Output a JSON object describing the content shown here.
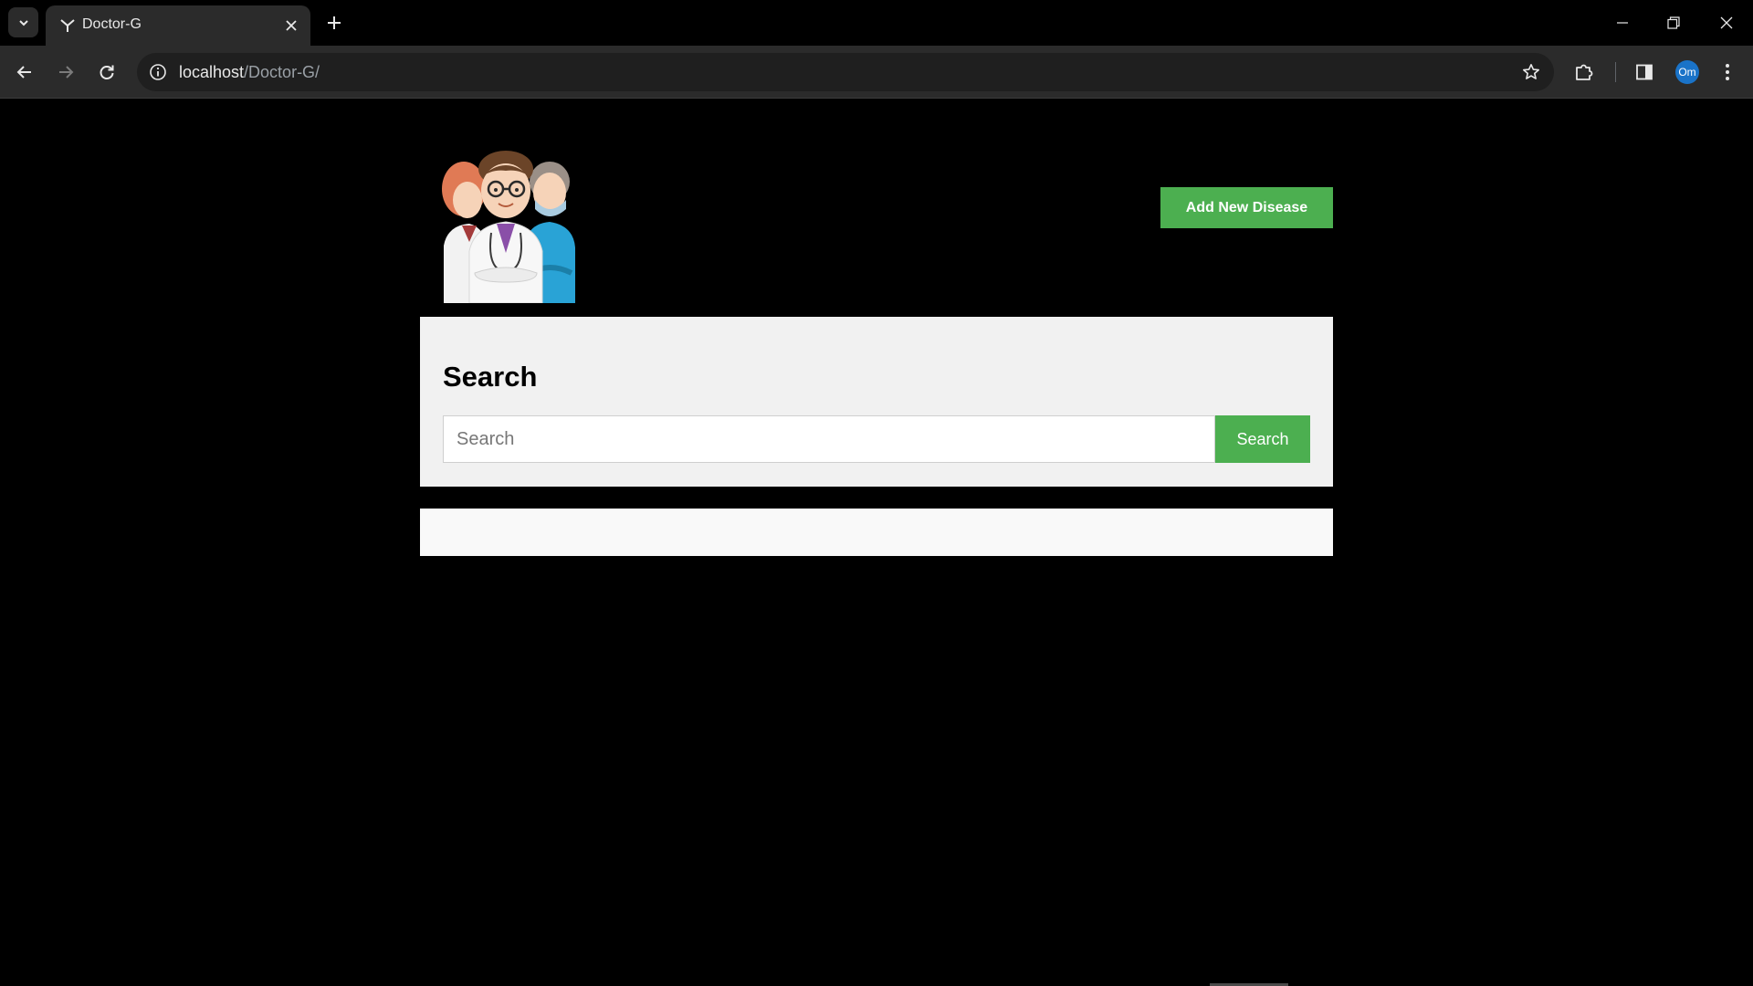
{
  "browser": {
    "tab_title": "Doctor-G",
    "url_host": "localhost",
    "url_path": "/Doctor-G/",
    "profile_initials": "Om"
  },
  "page": {
    "logo_alt": "doctors-illustration",
    "add_button_label": "Add New Disease",
    "search": {
      "heading": "Search",
      "placeholder": "Search",
      "value": "",
      "button_label": "Search"
    }
  },
  "colors": {
    "accent_green": "#4caf50",
    "page_background": "#000000",
    "card_background": "#f1f1f1",
    "results_background": "#f9f9f9"
  }
}
